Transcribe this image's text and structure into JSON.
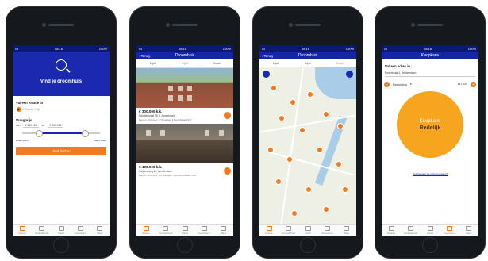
{
  "colors": {
    "accent": "#f47a1f",
    "primary": "#1b28b0",
    "circle": "#f7a51e"
  },
  "status": {
    "time": "08:16",
    "carrier": "•••",
    "battery": "100%"
  },
  "tabs": [
    "Zoeken",
    "Kenbaarheid",
    "Kaart",
    "Favorieten",
    "Meer"
  ],
  "s1": {
    "title": "Vind je droomhuis",
    "location_label": "Vul een locatie in",
    "location_placeholder": "Straat, Plaats, Wijk",
    "price_label": "Vraagprijs",
    "from_prefix": "van",
    "from_cur": "€",
    "from_value": "150.000",
    "to_prefix": "tot",
    "to_cur": "€",
    "to_value": "500.000",
    "link_left": "Reset filters",
    "link_right": "Meer filters",
    "cta": "Vind huizen"
  },
  "s2": {
    "back": "Terug",
    "title": "Droomhuis",
    "segs": [
      "Lijst",
      "Lijst",
      "Kaart"
    ],
    "cards": [
      {
        "price": "€ 300.000 k.k.",
        "addr": "Relatiestraat 98 B, Amsterdam",
        "meta": "Kamers: 3 Perceel: 97 Bouwjaar: 3 Beschikbaar 2017"
      },
      {
        "price": "€ 480.000 k.k.",
        "addr": "Kuipersweg 12, Amsterdam",
        "meta": "Kamers: 3 Perceel: 122 Bouwjaar: 1960 Beschikbaar 2017"
      }
    ]
  },
  "s3": {
    "back": "Terug",
    "title": "Droomhuis",
    "segs": [
      "Lijst",
      "Lijst",
      "Kaart"
    ]
  },
  "s4": {
    "title": "Koopkans",
    "addr_label": "Vul een adres in",
    "addr_value": "Roomhuis 1, Amsterdam",
    "bid_label": "Max bedrag",
    "bid_cur": "€",
    "bid_value": "147.000",
    "circle_top": "Koopkans",
    "circle_bottom": "Redelijk",
    "ask": "Hoe bepalen we onze koopkans?"
  }
}
